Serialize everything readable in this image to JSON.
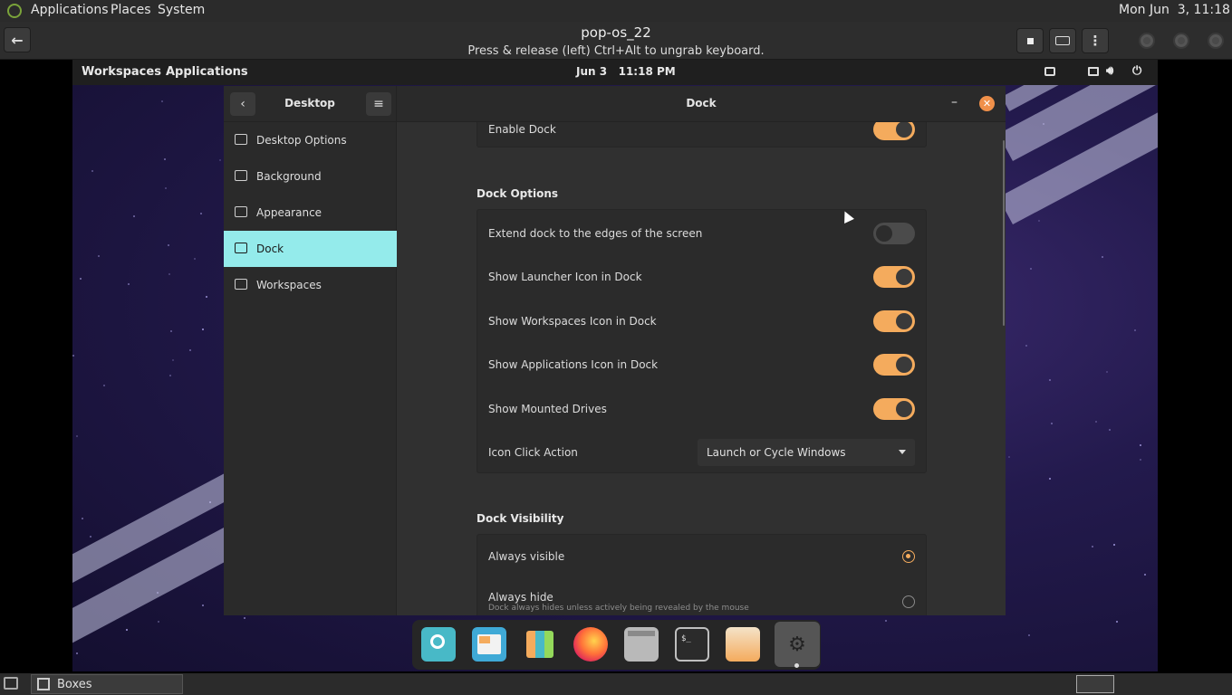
{
  "host_panel": {
    "menus": [
      "Applications",
      "Places",
      "System"
    ],
    "clock": "Mon Jun  3, 11:18 PM"
  },
  "boxes_header": {
    "title": "pop-os_22",
    "subtitle": "Press & release (left) Ctrl+Alt to ungrab keyboard."
  },
  "guest_panel": {
    "workspaces": "Workspaces",
    "applications": "Applications",
    "clock": "Jun 3   11:18 PM"
  },
  "settings": {
    "sidebar_title": "Desktop",
    "window_title": "Dock",
    "sidebar_items": [
      {
        "label": "Desktop Options",
        "icon": "monitor-icon"
      },
      {
        "label": "Background",
        "icon": "background-icon"
      },
      {
        "label": "Appearance",
        "icon": "appearance-icon"
      },
      {
        "label": "Dock",
        "icon": "dock-icon"
      },
      {
        "label": "Workspaces",
        "icon": "workspaces-icon"
      }
    ],
    "active_item": "Dock",
    "enable_dock_label": "Enable Dock",
    "dock_options_title": "Dock Options",
    "dock_options": [
      {
        "label": "Extend dock to the edges of the screen",
        "on": false
      },
      {
        "label": "Show Launcher Icon in Dock",
        "on": true
      },
      {
        "label": "Show Workspaces Icon in Dock",
        "on": true
      },
      {
        "label": "Show Applications Icon in Dock",
        "on": true
      },
      {
        "label": "Show Mounted Drives",
        "on": true
      }
    ],
    "icon_click_action_label": "Icon Click Action",
    "icon_click_action_value": "Launch or Cycle Windows",
    "dock_visibility_title": "Dock Visibility",
    "always_visible_label": "Always visible",
    "always_hide_label": "Always hide",
    "always_hide_desc": "Dock always hides unless actively being revealed by the mouse"
  },
  "dock_apps": [
    "search-icon",
    "pop-shop-icon",
    "app-grid-icon",
    "firefox-icon",
    "files-icon",
    "terminal-icon",
    "installer-icon",
    "settings-icon"
  ],
  "host_taskbar": {
    "item": "Boxes"
  },
  "colors": {
    "accent": "#f4ab5d",
    "active_item": "#94ebeb"
  }
}
